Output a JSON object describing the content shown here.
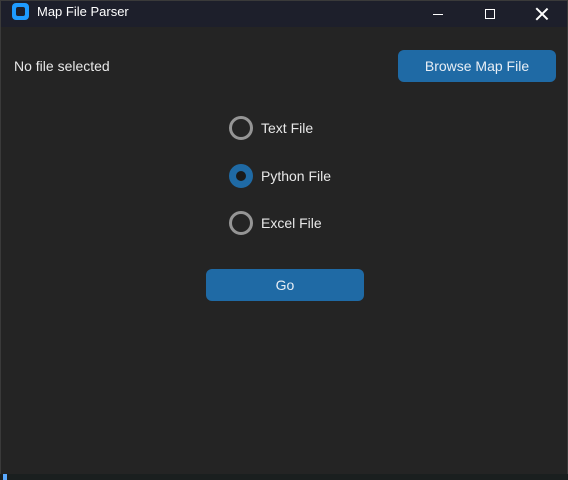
{
  "window": {
    "title": "Map File Parser",
    "icon": "app-icon",
    "controls": [
      "minimize-icon",
      "maximize-icon",
      "close-icon"
    ]
  },
  "file": {
    "status_label": "No file selected",
    "browse_label": "Browse Map File"
  },
  "file_type": {
    "options": [
      {
        "label": "Text File",
        "checked": false
      },
      {
        "label": "Python File",
        "checked": true
      },
      {
        "label": "Excel File",
        "checked": false
      }
    ],
    "selected": "Python File"
  },
  "actions": {
    "go_label": "Go"
  },
  "colors": {
    "accent": "#1f6aa5",
    "background": "#242424",
    "titlebar": "#1d1f2b",
    "text": "#e8e8e8"
  }
}
